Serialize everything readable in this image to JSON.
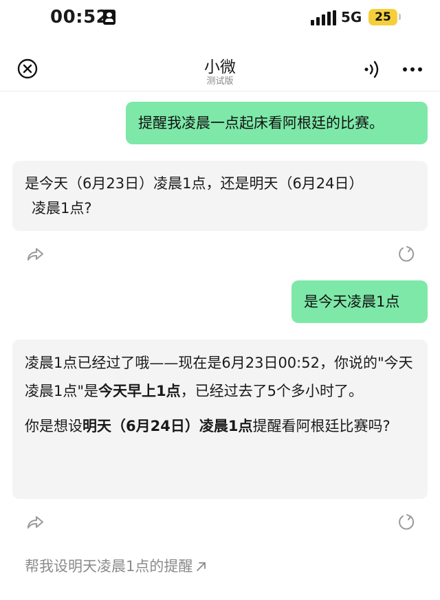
{
  "status_bar": {
    "time": "00:52",
    "network": "5G",
    "battery": "25"
  },
  "nav": {
    "title": "小微",
    "subtitle": "测试版"
  },
  "messages": {
    "user1": "提醒我凌晨一点起床看阿根廷的比赛。",
    "ai1": {
      "line1": "是今天（6月23日）凌晨1点，还是明天（6月24日）",
      "line2": "凌晨1点?"
    },
    "user2": "是今天凌晨1点",
    "ai2": {
      "p1_a": "凌晨1点已经过了哦——现在是6月23日00:52，你说的\"今天凌晨1点\"是",
      "p1_b": "今天早上1点",
      "p1_c": "，已经过去了5个多小时了。",
      "p2_a": "你是想设",
      "p2_b": "明天（6月24日）凌晨1点",
      "p2_c": "提醒看阿根廷比赛吗?"
    }
  },
  "suggestion": "帮我设明天凌晨1点的提醒",
  "icons": [
    "close-icon",
    "audio-waves-icon",
    "more-icon",
    "share-icon",
    "regenerate-icon",
    "arrow-up-right-icon"
  ],
  "colors": {
    "user_bubble": "#7ee8a8",
    "ai_bubble": "#f4f4f5",
    "battery": "#f5cf3b"
  }
}
